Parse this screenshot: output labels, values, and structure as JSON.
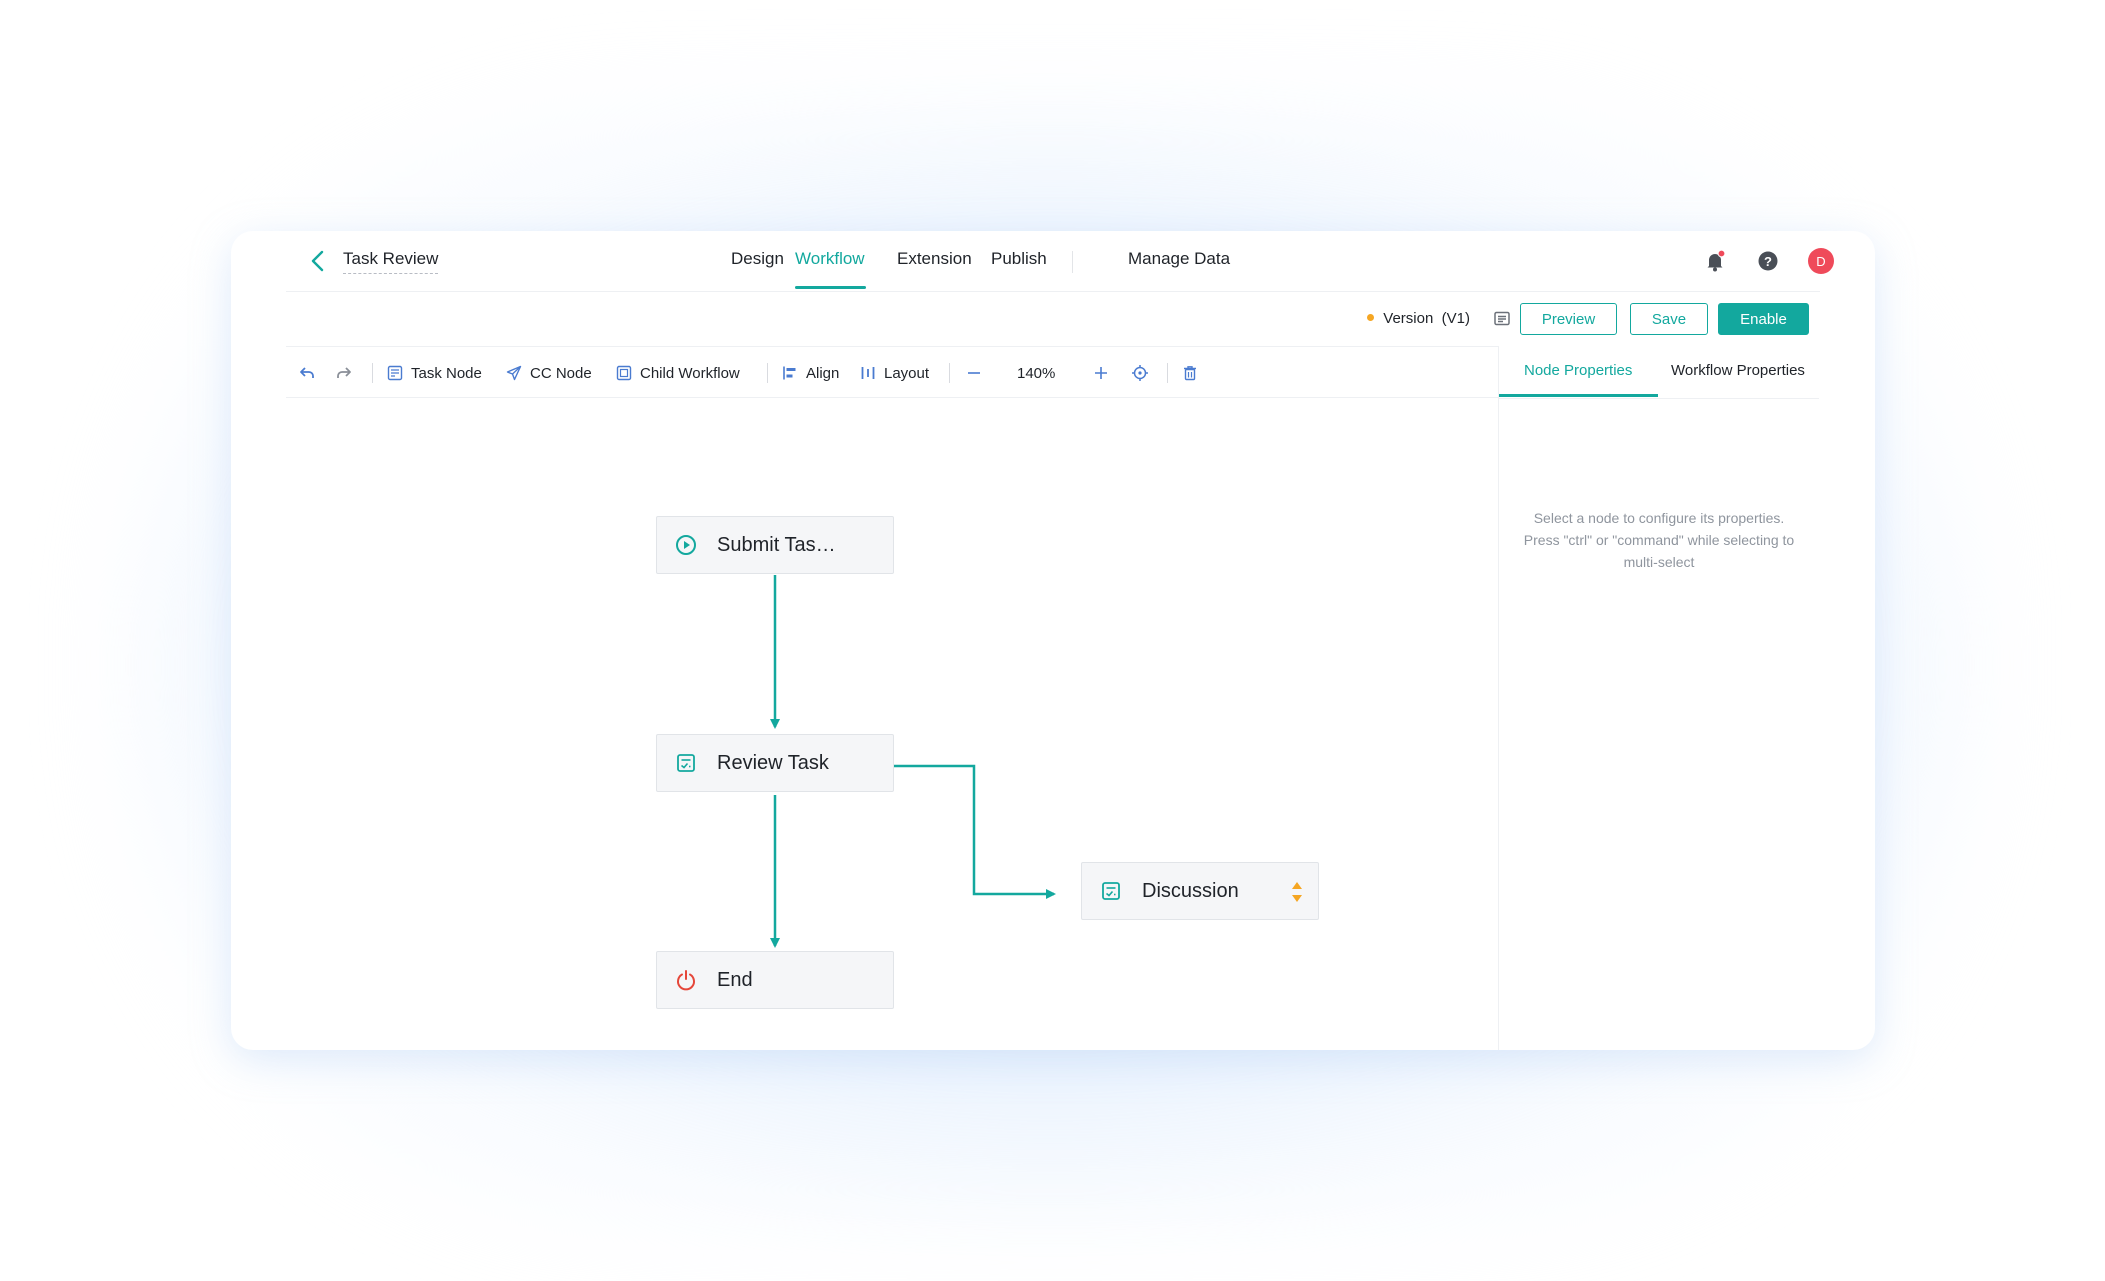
{
  "header": {
    "app_title": "Task Review",
    "nav": [
      {
        "label": "Design"
      },
      {
        "label": "Workflow",
        "active": true
      },
      {
        "label": "Extension"
      },
      {
        "label": "Publish"
      },
      {
        "label": "Manage Data"
      }
    ],
    "avatar_initial": "D"
  },
  "actionbar": {
    "version_label": "Version",
    "version_value": "(V1)",
    "preview_label": "Preview",
    "save_label": "Save",
    "enable_label": "Enable"
  },
  "toolbar": {
    "task_node": "Task Node",
    "cc_node": "CC Node",
    "child_workflow": "Child Workflow",
    "align": "Align",
    "layout": "Layout",
    "zoom": "140%"
  },
  "side_panel": {
    "tabs": [
      {
        "label": "Node Properties",
        "active": true
      },
      {
        "label": "Workflow Properties"
      }
    ],
    "hint_lines": [
      "Select a node to configure its properties.",
      "Press \"ctrl\" or \"command\" while selecting to",
      "multi-select"
    ]
  },
  "nodes": [
    {
      "label": "Submit Tas…",
      "icon": "play-circle-icon"
    },
    {
      "label": "Review Task",
      "icon": "task-form-icon"
    },
    {
      "label": "Discussion",
      "icon": "task-form-icon"
    },
    {
      "label": "End",
      "icon": "power-icon"
    }
  ],
  "colors": {
    "accent": "#13a89e",
    "end_icon": "#e5473a",
    "notification_dot": "#ef4a5a",
    "version_dot": "#f5a623",
    "node_tag": "#f5a623"
  }
}
